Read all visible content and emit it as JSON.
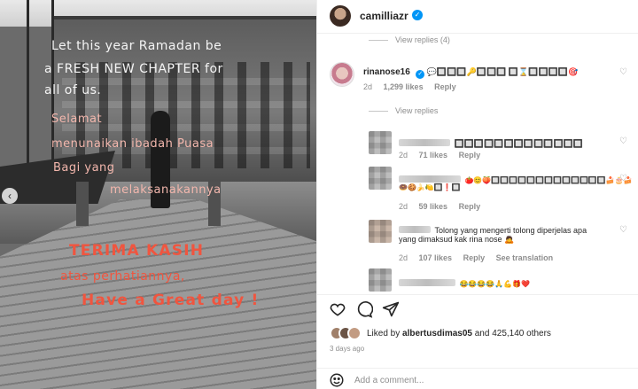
{
  "post_image": {
    "caption_lines_white": [
      "Let this year Ramadan be",
      "a FRESH NEW CHAPTER for",
      "all of us."
    ],
    "caption_lines_pink": [
      "Selamat",
      "menunaikan ibadah Puasa",
      "Bagi yang",
      "melaksanakannya"
    ],
    "caption_lines_red": [
      "TERIMA KASIH",
      "atas perhatiannya,",
      "Have a Great day !"
    ],
    "prev_arrow": "‹"
  },
  "header": {
    "username": "camilliazr",
    "verified_mark": "✓"
  },
  "comments": {
    "view_replies_top": "View replies (4)",
    "main": {
      "username": "rinanose16",
      "verified_mark": "✓",
      "text": "💬🔲🔲🔲🔑🔲🔲🔲 🔲⌛🔲🔲🔲🔲🎯",
      "time": "2d",
      "likes": "1,299 likes",
      "reply": "Reply"
    },
    "view_replies": "View replies",
    "replies": [
      {
        "text": "🔲🔲🔲🔲🔲🔲🔲🔲🔲🔲🔲🔲🔲",
        "time": "2d",
        "likes": "71 likes",
        "reply": "Reply"
      },
      {
        "text": "🍅😊🍑🔲🔲🔲🔲🔲🔲🔲🔲🔲🔲🔲🔲🔲🍰🎂🍰",
        "text2": "🍩🍪🍌🍋🔲❗🔲",
        "time": "2d",
        "likes": "59 likes",
        "reply": "Reply"
      },
      {
        "text": "Tolong yang mengerti tolong diperjelas apa",
        "text2": "yang dimaksud kak rina nose 🙇",
        "time": "2d",
        "likes": "107 likes",
        "reply": "Reply",
        "see_translation": "See translation"
      },
      {
        "text": "😂😂😂😂🙏💪🎁❤️"
      }
    ]
  },
  "likes": {
    "prefix": "Liked by",
    "user": "albertusdimas05",
    "suffix": "and 425,140 others"
  },
  "post_time": "3 days ago",
  "add_comment": {
    "placeholder": "Add a comment..."
  }
}
